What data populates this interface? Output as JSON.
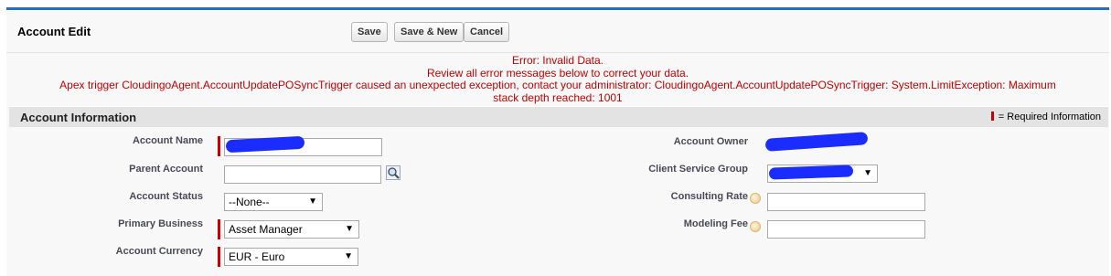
{
  "header": {
    "title": "Account Edit",
    "save_label": "Save",
    "save_new_label": "Save & New",
    "cancel_label": "Cancel"
  },
  "errors": {
    "line1": "Error: Invalid Data.",
    "line2": "Review all error messages below to correct your data.",
    "line3": "Apex trigger CloudingoAgent.AccountUpdatePOSyncTrigger caused an unexpected exception, contact your administrator: CloudingoAgent.AccountUpdatePOSyncTrigger: System.LimitException: Maximum",
    "line4": "stack depth reached: 1001"
  },
  "section": {
    "title": "Account Information",
    "required_legend": "= Required Information"
  },
  "fields": {
    "account_name": {
      "label": "Account Name",
      "value": ""
    },
    "parent_account": {
      "label": "Parent Account",
      "value": ""
    },
    "account_status": {
      "label": "Account Status",
      "value": "--None--"
    },
    "primary_business": {
      "label": "Primary Business",
      "value": "Asset Manager"
    },
    "account_currency": {
      "label": "Account Currency",
      "value": "EUR - Euro"
    },
    "account_owner": {
      "label": "Account Owner"
    },
    "client_service_group": {
      "label": "Client Service Group",
      "value": ""
    },
    "consulting_rate": {
      "label": "Consulting Rate",
      "value": ""
    },
    "modeling_fee": {
      "label": "Modeling Fee",
      "value": ""
    }
  },
  "icons": {
    "lookup": "magnifier-lookup-icon",
    "help": "info-bubble-icon",
    "dropdown": "chevron-down-icon"
  },
  "colors": {
    "accent": "#236fbd",
    "error": "#c00000",
    "required": "#cc0000",
    "redaction": "#1a2cff"
  }
}
